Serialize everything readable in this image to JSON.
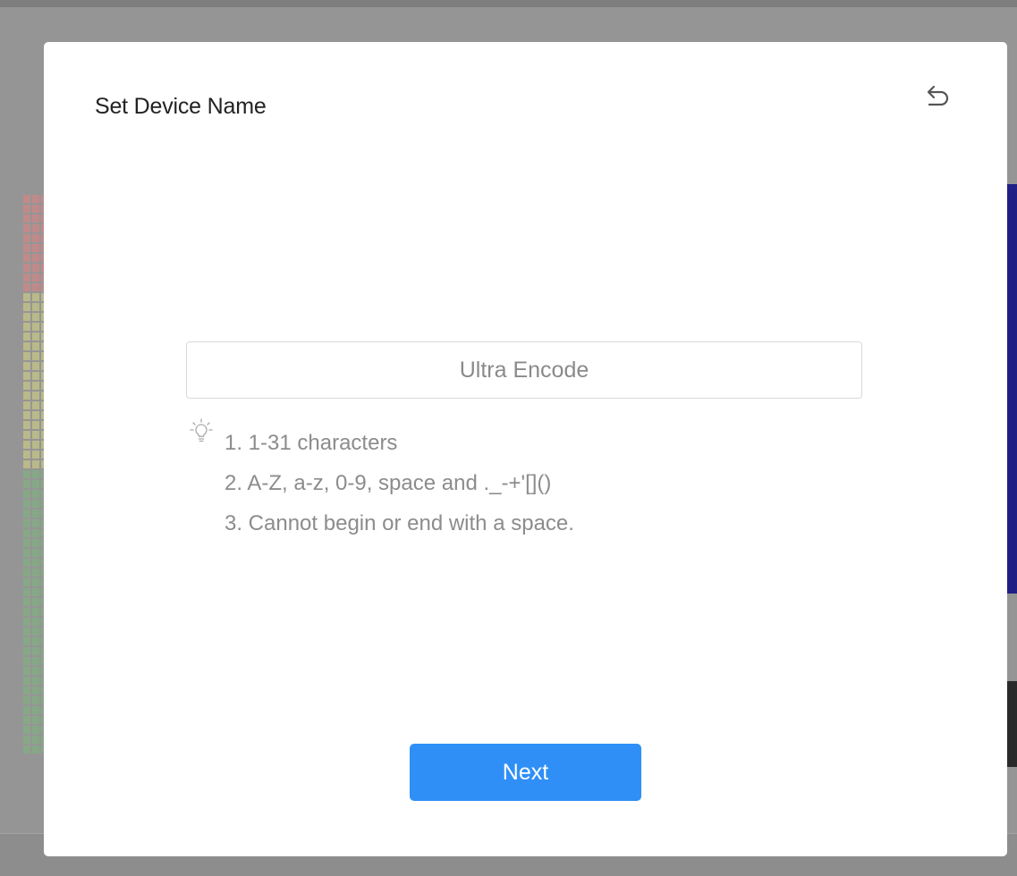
{
  "dialog": {
    "title": "Set Device Name",
    "back_icon": "undo-arrow-icon",
    "device_name_value": "Ultra Encode",
    "tip_icon": "lightbulb-icon",
    "rules": [
      "1. 1-31 characters",
      "2. A-Z, a-z, 0-9, space and ._-+'[]()",
      "3. Cannot begin or end with a space."
    ],
    "next_label": "Next"
  },
  "colors": {
    "primary_button": "#2f8ff6",
    "overlay": "#959595",
    "modal_bg": "#ffffff",
    "rule_text": "#8c8c8c",
    "meter_red": "#c08a8a",
    "meter_yellow": "#b9b98a",
    "meter_green": "#86a886"
  }
}
